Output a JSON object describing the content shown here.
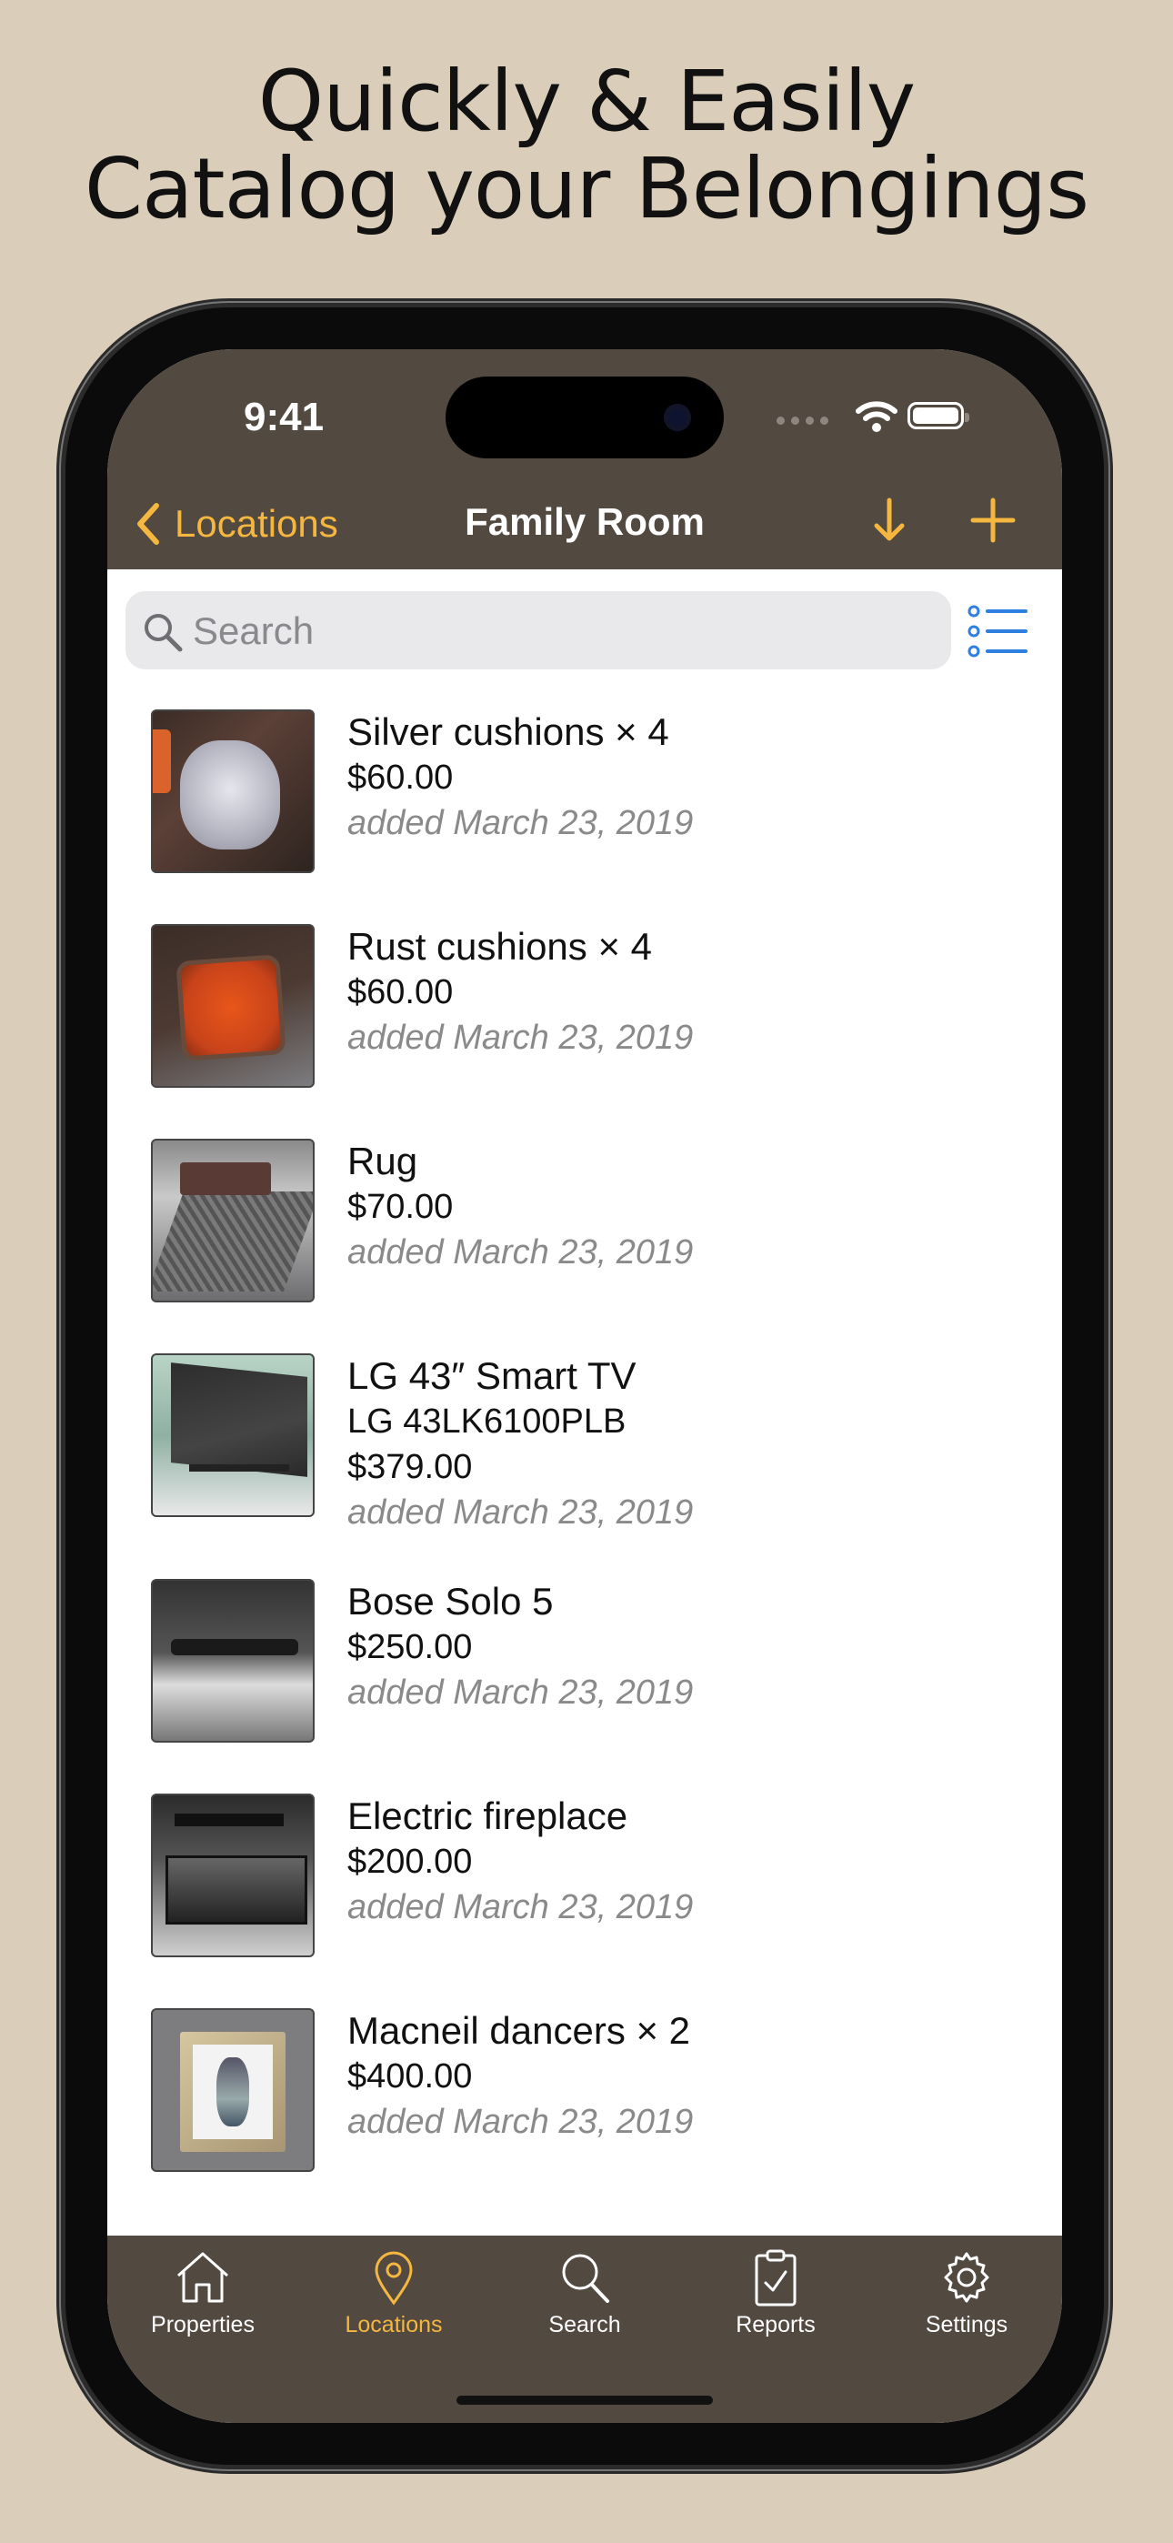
{
  "headline": {
    "line1": "Quickly & Easily",
    "line2": "Catalog your Belongings"
  },
  "status_bar": {
    "time": "9:41"
  },
  "nav": {
    "back_label": "Locations",
    "title": "Family Room",
    "sort_icon": "arrow-down-icon",
    "add_icon": "plus-icon"
  },
  "search": {
    "placeholder": "Search",
    "value": ""
  },
  "items": [
    {
      "name": "Silver cushions × 4",
      "price": "$60.00",
      "added": "added March 23, 2019",
      "thumb": "silver-cushion"
    },
    {
      "name": "Rust cushions × 4",
      "price": "$60.00",
      "added": "added March 23, 2019",
      "thumb": "rust-cushion"
    },
    {
      "name": "Rug",
      "price": "$70.00",
      "added": "added March 23, 2019",
      "thumb": "rug"
    },
    {
      "name": "LG 43″ Smart TV",
      "model": "LG 43LK6100PLB",
      "price": "$379.00",
      "added": "added March 23, 2019",
      "thumb": "tv"
    },
    {
      "name": "Bose Solo 5",
      "price": "$250.00",
      "added": "added March 23, 2019",
      "thumb": "soundbar"
    },
    {
      "name": "Electric fireplace",
      "price": "$200.00",
      "added": "added March 23, 2019",
      "thumb": "fireplace"
    },
    {
      "name": "Macneil dancers × 2",
      "price": "$400.00",
      "added": "added March 23, 2019",
      "thumb": "painting"
    }
  ],
  "tabs": [
    {
      "label": "Properties",
      "icon": "house-icon",
      "active": false
    },
    {
      "label": "Locations",
      "icon": "location-pin-icon",
      "active": true
    },
    {
      "label": "Search",
      "icon": "magnifier-icon",
      "active": false
    },
    {
      "label": "Reports",
      "icon": "clipboard-check-icon",
      "active": false
    },
    {
      "label": "Settings",
      "icon": "gear-icon",
      "active": false
    }
  ],
  "colors": {
    "background": "#dacdb9",
    "bar": "#524941",
    "accent": "#f5b73f",
    "list_icon_blue": "#2f7fe0"
  }
}
